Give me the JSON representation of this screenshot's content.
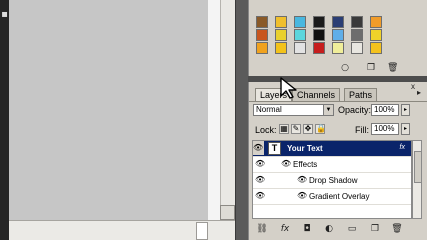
{
  "swatches": {
    "rows": [
      [
        "#8a5a28",
        "#f0bf2c",
        "#49b7df",
        "#1b1b1b",
        "#2b3e74",
        "#3a3a3a",
        "#f09c2a"
      ],
      [
        "#c8551e",
        "#e8d02e",
        "#5cd6dc",
        "#111111",
        "#5faee8",
        "#6d6d6d",
        "#f0d22a"
      ],
      [
        "#f0a21e",
        "#f2c21a",
        "#e2e2e2",
        "#c61e1e",
        "#f0ee9a",
        "#e8e6e0",
        "#f4c21e"
      ]
    ],
    "footer_icons": [
      "circle-icon",
      "new-icon",
      "trash-icon"
    ]
  },
  "layers_panel": {
    "tabs": [
      {
        "label": "Layers",
        "active": true
      },
      {
        "label": "Channels",
        "active": false
      },
      {
        "label": "Paths",
        "active": false
      }
    ],
    "close_glyph": "x",
    "menu_glyph": "▸",
    "blend_mode": "Normal",
    "opacity_label": "Opacity:",
    "opacity_value": "100%",
    "lock_label": "Lock:",
    "fill_label": "Fill:",
    "fill_value": "100%",
    "layers": [
      {
        "name": "Your Text",
        "type": "text",
        "thumb": "T",
        "fx": "fx",
        "selected": true
      },
      {
        "name": "Effects",
        "type": "effects-group"
      },
      {
        "name": "Drop Shadow",
        "type": "effect"
      },
      {
        "name": "Gradient Overlay",
        "type": "effect"
      }
    ],
    "footer_icons": [
      "link-icon",
      "fx-icon",
      "mask-icon",
      "adjustment-icon",
      "folder-icon",
      "new-layer-icon",
      "trash-icon"
    ],
    "footer_glyphs": [
      "⛓",
      "fx",
      "◘",
      "◐",
      "▭",
      "❐",
      "🗑"
    ]
  },
  "glyphs": {
    "dropdown": "▼",
    "stepper": "▸",
    "eye": "👁",
    "lock_transparent": "▦",
    "lock_paint": "✎",
    "lock_move": "✥",
    "lock_all": "🔒",
    "corner": "▪"
  }
}
